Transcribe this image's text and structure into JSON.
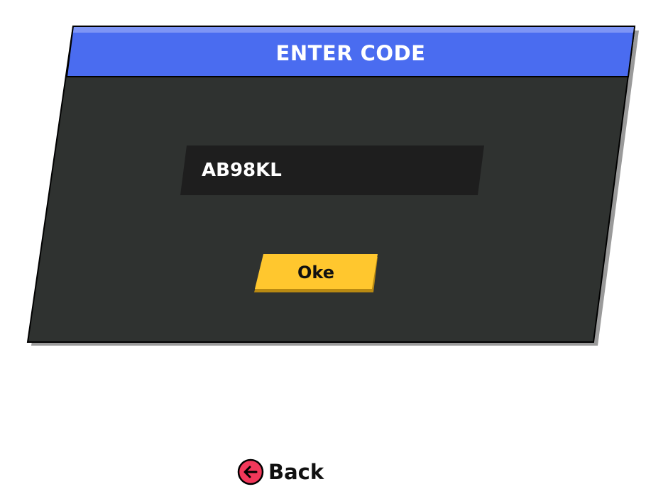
{
  "dialog": {
    "title": "ENTER CODE",
    "code_value": "AB98KL",
    "ok_label": "Oke"
  },
  "back": {
    "label": "Back",
    "icon": "arrow-left-circle-icon"
  },
  "colors": {
    "header_blue": "#4a6cf0",
    "panel_dark": "#2f3230",
    "field_dark": "#1e1e1e",
    "button_yellow": "#ffc72e",
    "button_shadow": "#b98a12",
    "back_icon_red": "#f2385a"
  }
}
